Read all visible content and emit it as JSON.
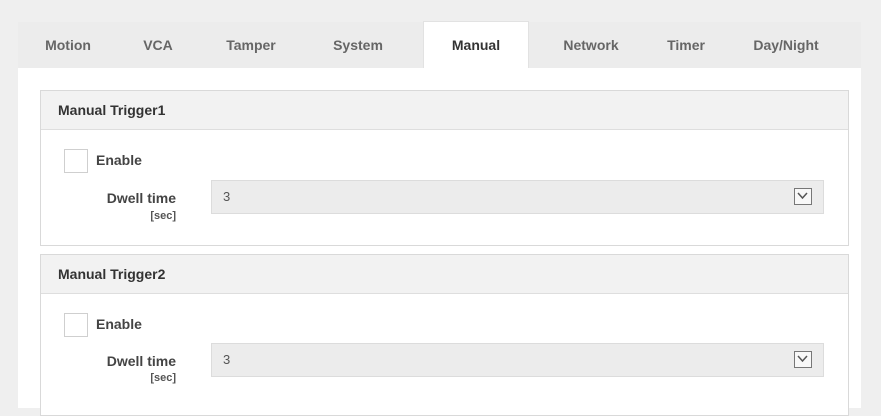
{
  "tabs": [
    {
      "label": "Motion",
      "active": false
    },
    {
      "label": "VCA",
      "active": false
    },
    {
      "label": "Tamper",
      "active": false
    },
    {
      "label": "System",
      "active": false
    },
    {
      "label": "Manual",
      "active": true
    },
    {
      "label": "Network",
      "active": false
    },
    {
      "label": "Timer",
      "active": false
    },
    {
      "label": "Day/Night",
      "active": false
    }
  ],
  "triggers": [
    {
      "title": "Manual Trigger1",
      "enable_label": "Enable",
      "enabled": false,
      "dwell_label": "Dwell time",
      "dwell_unit": "[sec]",
      "dwell_value": "3"
    },
    {
      "title": "Manual Trigger2",
      "enable_label": "Enable",
      "enabled": false,
      "dwell_label": "Dwell time",
      "dwell_unit": "[sec]",
      "dwell_value": "3"
    }
  ]
}
